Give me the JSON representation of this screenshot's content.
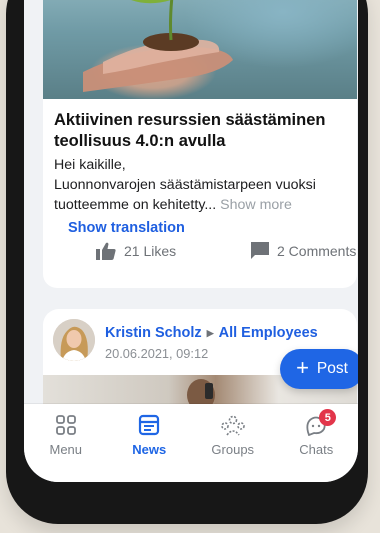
{
  "post1": {
    "title": "Aktiivinen resurssien säästäminen teollisuus 4.0:n avulla",
    "greeting": "Hei kaikille,",
    "body_line2": "Luonnonvarojen säästämistarpeen vuoksi",
    "body_line3": "tuotteemme on kehitetty...",
    "show_more": "Show more",
    "show_translation": "Show translation",
    "likes": "21 Likes",
    "comments": "2 Comments"
  },
  "post2": {
    "author": "Kristin Scholz",
    "audience": "All Employees",
    "date": "20.06.2021, 09:12"
  },
  "fab": {
    "label": "Post"
  },
  "nav": {
    "menu": "Menu",
    "news": "News",
    "groups": "Groups",
    "chats": "Chats",
    "chats_badge": "5"
  },
  "colors": {
    "accent": "#1f66e5",
    "badge": "#e2354a",
    "feed_bg": "#f0f2f5"
  }
}
